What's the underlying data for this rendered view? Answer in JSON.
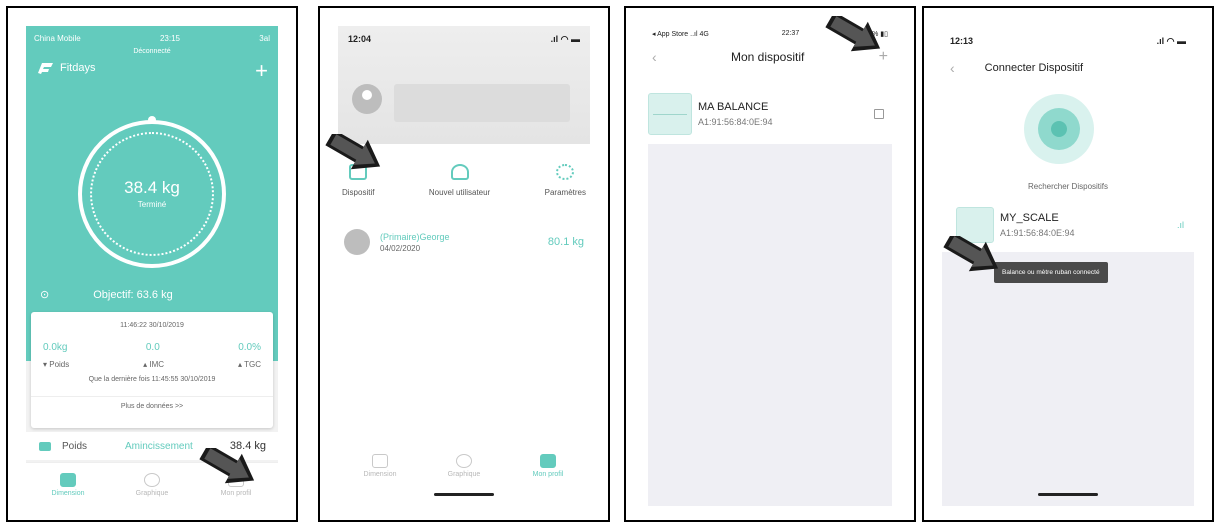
{
  "screen1": {
    "status": {
      "carrier": "China Mobile",
      "time": "23:15",
      "subtitle": "Déconnecté",
      "battery": "3al"
    },
    "app_name": "Fitdays",
    "ring": {
      "weight": "38.4 kg",
      "status": "Terminé"
    },
    "goal": "Objectif: 63.6 kg",
    "card": {
      "timestamp": "11:46:22 30/10/2019",
      "values": [
        "0.0kg",
        "0.0",
        "0.0%"
      ],
      "labels": [
        "▾ Poids",
        "▴ IMC",
        "▴ TGC"
      ],
      "last_time": "Que la dernière fois 11:45:55 30/10/2019",
      "more": "Plus de données >>"
    },
    "poids_row": {
      "label": "Poids",
      "status": "Amincissement",
      "value": "38.4 kg"
    },
    "tabs": [
      "Dimension",
      "Graphique",
      "Mon profil"
    ]
  },
  "screen2": {
    "status": {
      "time": "12:04"
    },
    "actions": [
      "Dispositif",
      "Nouvel utilisateur",
      "Paramètres"
    ],
    "user": {
      "name": "(Primaire)George",
      "date": "04/02/2020",
      "weight": "80.1 kg"
    },
    "tabs": [
      "Dimension",
      "Graphique",
      "Mon profil"
    ]
  },
  "screen3": {
    "status": {
      "left": "◂ App Store ..ıl 4G",
      "time": "22:37",
      "right": "% ▮▯"
    },
    "title": "Mon dispositif",
    "device": {
      "name": "MA BALANCE",
      "mac": "A1:91:56:84:0E:94"
    }
  },
  "screen4": {
    "status": {
      "time": "12:13"
    },
    "title": "Connecter Dispositif",
    "search_label": "Rechercher Dispositifs",
    "device": {
      "name": "MY_SCALE",
      "mac": "A1:91:56:84:0E:94"
    },
    "toast": "Balance ou mètre ruban connecté"
  },
  "colors": {
    "accent": "#63cbbd",
    "arrow": "#1a1a1a"
  },
  "icons": [
    "plus-icon",
    "back-icon",
    "edit-icon",
    "gear-icon",
    "user-add-icon",
    "device-icon",
    "scale-icon",
    "signal-icon",
    "pointer-arrow-icon"
  ]
}
